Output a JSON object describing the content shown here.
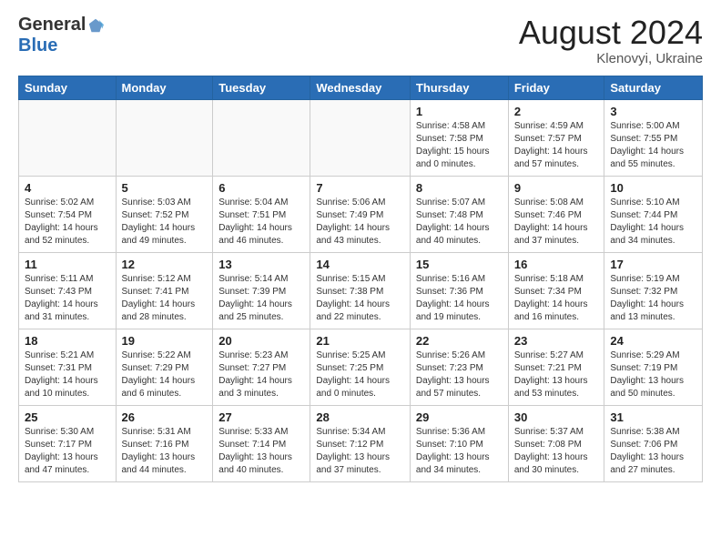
{
  "header": {
    "logo_general": "General",
    "logo_blue": "Blue",
    "month_title": "August 2024",
    "subtitle": "Klenovyi, Ukraine"
  },
  "weekdays": [
    "Sunday",
    "Monday",
    "Tuesday",
    "Wednesday",
    "Thursday",
    "Friday",
    "Saturday"
  ],
  "weeks": [
    [
      {
        "day": "",
        "info": ""
      },
      {
        "day": "",
        "info": ""
      },
      {
        "day": "",
        "info": ""
      },
      {
        "day": "",
        "info": ""
      },
      {
        "day": "1",
        "info": "Sunrise: 4:58 AM\nSunset: 7:58 PM\nDaylight: 15 hours and 0 minutes."
      },
      {
        "day": "2",
        "info": "Sunrise: 4:59 AM\nSunset: 7:57 PM\nDaylight: 14 hours and 57 minutes."
      },
      {
        "day": "3",
        "info": "Sunrise: 5:00 AM\nSunset: 7:55 PM\nDaylight: 14 hours and 55 minutes."
      }
    ],
    [
      {
        "day": "4",
        "info": "Sunrise: 5:02 AM\nSunset: 7:54 PM\nDaylight: 14 hours and 52 minutes."
      },
      {
        "day": "5",
        "info": "Sunrise: 5:03 AM\nSunset: 7:52 PM\nDaylight: 14 hours and 49 minutes."
      },
      {
        "day": "6",
        "info": "Sunrise: 5:04 AM\nSunset: 7:51 PM\nDaylight: 14 hours and 46 minutes."
      },
      {
        "day": "7",
        "info": "Sunrise: 5:06 AM\nSunset: 7:49 PM\nDaylight: 14 hours and 43 minutes."
      },
      {
        "day": "8",
        "info": "Sunrise: 5:07 AM\nSunset: 7:48 PM\nDaylight: 14 hours and 40 minutes."
      },
      {
        "day": "9",
        "info": "Sunrise: 5:08 AM\nSunset: 7:46 PM\nDaylight: 14 hours and 37 minutes."
      },
      {
        "day": "10",
        "info": "Sunrise: 5:10 AM\nSunset: 7:44 PM\nDaylight: 14 hours and 34 minutes."
      }
    ],
    [
      {
        "day": "11",
        "info": "Sunrise: 5:11 AM\nSunset: 7:43 PM\nDaylight: 14 hours and 31 minutes."
      },
      {
        "day": "12",
        "info": "Sunrise: 5:12 AM\nSunset: 7:41 PM\nDaylight: 14 hours and 28 minutes."
      },
      {
        "day": "13",
        "info": "Sunrise: 5:14 AM\nSunset: 7:39 PM\nDaylight: 14 hours and 25 minutes."
      },
      {
        "day": "14",
        "info": "Sunrise: 5:15 AM\nSunset: 7:38 PM\nDaylight: 14 hours and 22 minutes."
      },
      {
        "day": "15",
        "info": "Sunrise: 5:16 AM\nSunset: 7:36 PM\nDaylight: 14 hours and 19 minutes."
      },
      {
        "day": "16",
        "info": "Sunrise: 5:18 AM\nSunset: 7:34 PM\nDaylight: 14 hours and 16 minutes."
      },
      {
        "day": "17",
        "info": "Sunrise: 5:19 AM\nSunset: 7:32 PM\nDaylight: 14 hours and 13 minutes."
      }
    ],
    [
      {
        "day": "18",
        "info": "Sunrise: 5:21 AM\nSunset: 7:31 PM\nDaylight: 14 hours and 10 minutes."
      },
      {
        "day": "19",
        "info": "Sunrise: 5:22 AM\nSunset: 7:29 PM\nDaylight: 14 hours and 6 minutes."
      },
      {
        "day": "20",
        "info": "Sunrise: 5:23 AM\nSunset: 7:27 PM\nDaylight: 14 hours and 3 minutes."
      },
      {
        "day": "21",
        "info": "Sunrise: 5:25 AM\nSunset: 7:25 PM\nDaylight: 14 hours and 0 minutes."
      },
      {
        "day": "22",
        "info": "Sunrise: 5:26 AM\nSunset: 7:23 PM\nDaylight: 13 hours and 57 minutes."
      },
      {
        "day": "23",
        "info": "Sunrise: 5:27 AM\nSunset: 7:21 PM\nDaylight: 13 hours and 53 minutes."
      },
      {
        "day": "24",
        "info": "Sunrise: 5:29 AM\nSunset: 7:19 PM\nDaylight: 13 hours and 50 minutes."
      }
    ],
    [
      {
        "day": "25",
        "info": "Sunrise: 5:30 AM\nSunset: 7:17 PM\nDaylight: 13 hours and 47 minutes."
      },
      {
        "day": "26",
        "info": "Sunrise: 5:31 AM\nSunset: 7:16 PM\nDaylight: 13 hours and 44 minutes."
      },
      {
        "day": "27",
        "info": "Sunrise: 5:33 AM\nSunset: 7:14 PM\nDaylight: 13 hours and 40 minutes."
      },
      {
        "day": "28",
        "info": "Sunrise: 5:34 AM\nSunset: 7:12 PM\nDaylight: 13 hours and 37 minutes."
      },
      {
        "day": "29",
        "info": "Sunrise: 5:36 AM\nSunset: 7:10 PM\nDaylight: 13 hours and 34 minutes."
      },
      {
        "day": "30",
        "info": "Sunrise: 5:37 AM\nSunset: 7:08 PM\nDaylight: 13 hours and 30 minutes."
      },
      {
        "day": "31",
        "info": "Sunrise: 5:38 AM\nSunset: 7:06 PM\nDaylight: 13 hours and 27 minutes."
      }
    ]
  ]
}
